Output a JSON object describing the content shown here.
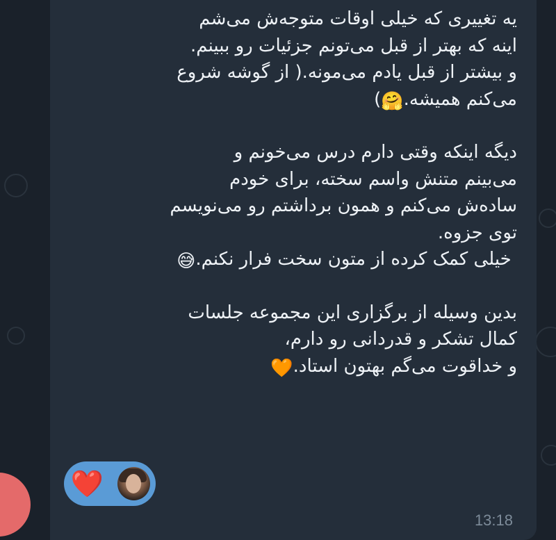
{
  "message": {
    "paragraph1": [
      "یه تغییری که خیلی اوقات متوجه‌ش می‌شم",
      "اینه که بهتر از قبل می‌تونم جزئیات رو ببینم.",
      "و بیشتر از قبل یادم می‌مونه.( از گوشه شروع",
      "می‌کنم همیشه."
    ],
    "paragraph1_tail": ")",
    "paragraph1_emoji": "🤗",
    "paragraph2": [
      "دیگه اینکه وقتی دارم درس می‌خونم و",
      "می‌بینم متنش واسم سخته، برای خودم",
      "ساده‌ش می‌کنم و همون برداشتم رو می‌نویسم",
      "توی جزوه."
    ],
    "paragraph2_last": " خیلی کمک کرده از متون سخت فرار نکنم.",
    "paragraph2_emoji": "😅",
    "paragraph3": [
      "بدین وسیله از برگزاری این مجموعه جلسات",
      "کمال تشکر و قدردانی رو دارم،"
    ],
    "paragraph3_last": "و خداقوت می‌گم بهتون استاد.",
    "paragraph3_emoji": "🧡"
  },
  "reaction": {
    "emoji": "❤️",
    "icon": "heart-icon"
  },
  "timestamp": "13:18",
  "colors": {
    "bubble": "#242e3a",
    "background": "#1a212a",
    "reaction_pill": "#5a9bd6",
    "text": "#eef2f6",
    "timestamp": "#7d8b99"
  }
}
